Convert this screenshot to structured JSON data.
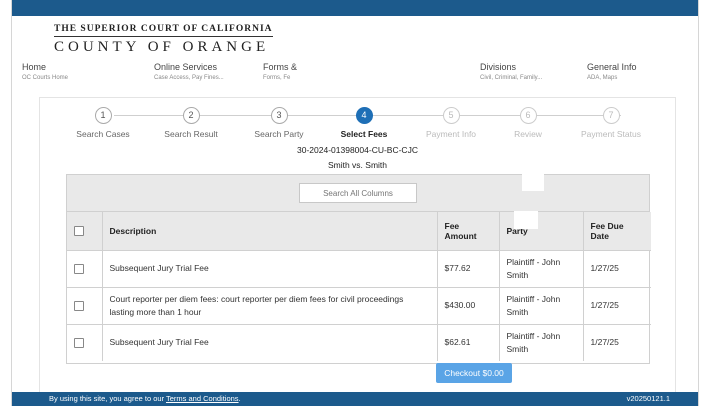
{
  "logo": {
    "line1": "THE SUPERIOR COURT OF CALIFORNIA",
    "line2": "COUNTY OF ORANGE"
  },
  "nav": [
    {
      "title": "Home",
      "sub": "OC Courts Home"
    },
    {
      "title": "Online Services",
      "sub": "Case Access, Pay Fines..."
    },
    {
      "title": "Forms &",
      "sub": "Forms, Fe"
    },
    {
      "title": "Divisions",
      "sub": "Civil, Criminal, Family..."
    },
    {
      "title": "General Info",
      "sub": "ADA, Maps"
    }
  ],
  "steps": [
    {
      "num": "1",
      "label": "Search Cases"
    },
    {
      "num": "2",
      "label": "Search Result"
    },
    {
      "num": "3",
      "label": "Search Party"
    },
    {
      "num": "4",
      "label": "Select Fees"
    },
    {
      "num": "5",
      "label": "Payment Info"
    },
    {
      "num": "6",
      "label": "Review"
    },
    {
      "num": "7",
      "label": "Payment Status"
    }
  ],
  "case": {
    "number": "30-2024-01398004-CU-BC-CJC",
    "title": "Smith vs. Smith"
  },
  "search": {
    "placeholder": "Search All Columns"
  },
  "table": {
    "headers": {
      "description": "Description",
      "fee_amount": "Fee Amount",
      "party": "Party",
      "fee_due_date": "Fee Due Date"
    },
    "rows": [
      {
        "description": "Subsequent Jury Trial Fee",
        "amount": "$77.62",
        "party": "Plaintiff - John Smith",
        "due": "1/27/25"
      },
      {
        "description": "Court reporter per diem fees: court reporter per diem fees for civil proceedings lasting more than 1 hour",
        "amount": "$430.00",
        "party": "Plaintiff - John Smith",
        "due": "1/27/25"
      },
      {
        "description": "Subsequent Jury Trial Fee",
        "amount": "$62.61",
        "party": "Plaintiff - John Smith",
        "due": "1/27/25"
      }
    ]
  },
  "checkout": {
    "label": "Checkout $0.00"
  },
  "footer": {
    "text_before": "By using this site, you agree to our ",
    "link": "Terms and Conditions",
    "text_after": ".",
    "version": "v20250121.1"
  }
}
